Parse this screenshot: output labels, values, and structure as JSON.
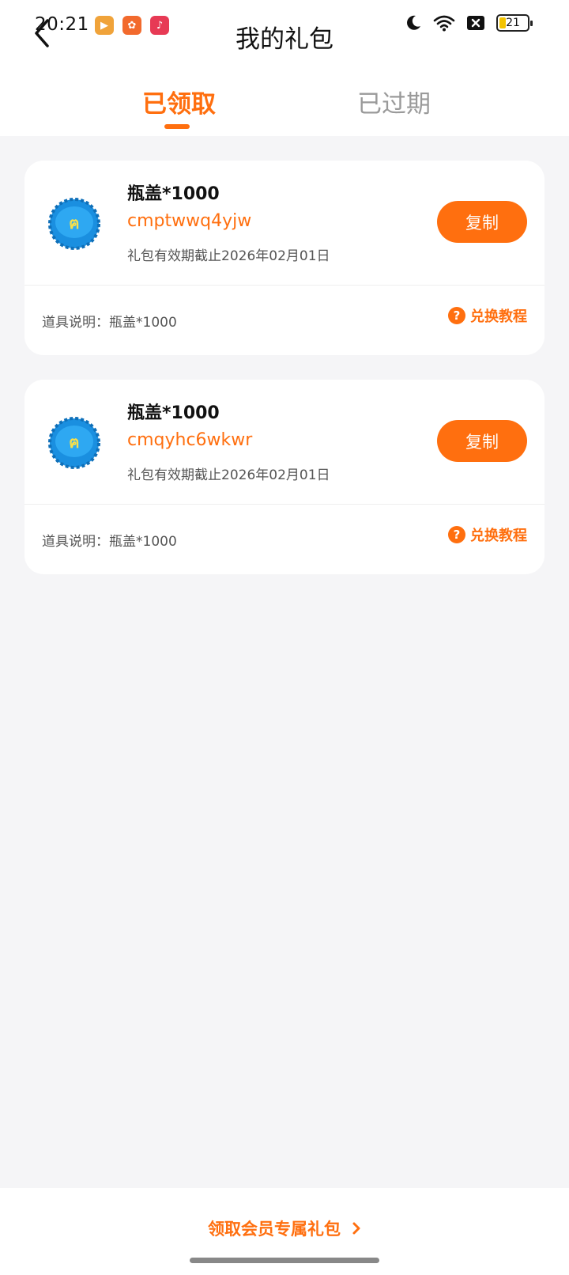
{
  "status_bar": {
    "time": "20:21",
    "battery_level": "21",
    "icons": [
      "video-app-icon",
      "kuaishou-app-icon",
      "music-app-icon",
      "moon-icon",
      "wifi-icon",
      "sim-blocked-icon",
      "battery-icon"
    ]
  },
  "header": {
    "title": "我的礼包"
  },
  "tabs": [
    {
      "label": "已领取",
      "active": true
    },
    {
      "label": "已过期",
      "active": false
    }
  ],
  "gifts": [
    {
      "name": "瓶盖*1000",
      "code": "cmptwwq4yjw",
      "expiry": "礼包有效期截止2026年02月01日",
      "copy_label": "复制",
      "description": "道具说明：瓶盖*1000",
      "tutorial_label": "兑换教程"
    },
    {
      "name": "瓶盖*1000",
      "code": "cmqyhc6wkwr",
      "expiry": "礼包有效期截止2026年02月01日",
      "copy_label": "复制",
      "description": "道具说明：瓶盖*1000",
      "tutorial_label": "兑换教程"
    }
  ],
  "footer": {
    "vip_link_label": "领取会员专属礼包"
  },
  "colors": {
    "accent": "#ff6f0f",
    "background": "#f5f5f7",
    "inactive_tab": "#9a9a9a"
  }
}
